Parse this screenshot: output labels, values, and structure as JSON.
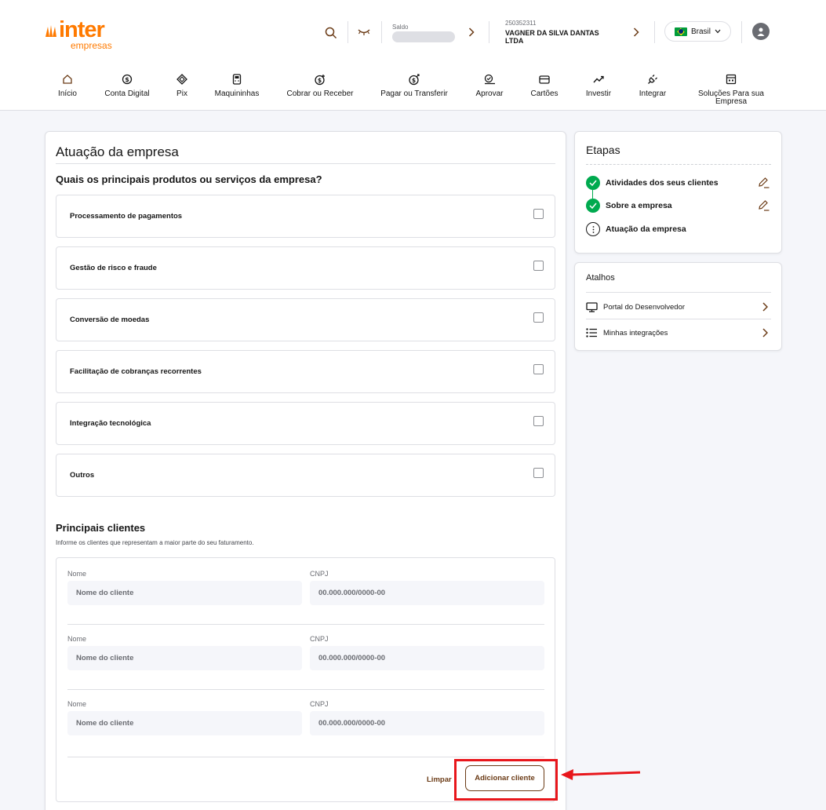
{
  "brand": {
    "name": "inter",
    "sub": "empresas",
    "color": "#ff7a00"
  },
  "header": {
    "saldo_label": "Saldo",
    "account_number": "250352311",
    "account_name": "VAGNER DA SILVA DANTAS LTDA",
    "country": "Brasil",
    "icons": [
      "search-icon",
      "hide-eye-icon",
      "chevron-right-icon",
      "user-icon"
    ]
  },
  "nav": [
    {
      "label": "Início",
      "icon": "home-icon"
    },
    {
      "label": "Conta Digital",
      "icon": "dollar-icon"
    },
    {
      "label": "Pix",
      "icon": "pix-icon"
    },
    {
      "label": "Maquininhas",
      "icon": "pos-icon"
    },
    {
      "label": "Cobrar ou Receber",
      "icon": "receive-icon"
    },
    {
      "label": "Pagar ou Transferir",
      "icon": "pay-icon"
    },
    {
      "label": "Aprovar",
      "icon": "approve-icon"
    },
    {
      "label": "Cartões",
      "icon": "card-icon"
    },
    {
      "label": "Investir",
      "icon": "invest-icon"
    },
    {
      "label": "Integrar",
      "icon": "plug-icon"
    },
    {
      "label": "Soluções Para sua Empresa",
      "icon": "store-icon"
    }
  ],
  "main": {
    "title": "Atuação da empresa",
    "question": "Quais os principais produtos ou serviços da empresa?",
    "options": [
      "Processamento de pagamentos",
      "Gestão de risco e fraude",
      "Conversão de moedas",
      "Facilitação de cobranças recorrentes",
      "Integração tecnológica",
      "Outros"
    ],
    "clients_title": "Principais clientes",
    "clients_hint": "Informe os clientes que representam a maior parte do seu faturamento.",
    "clients": [
      {
        "name_label": "Nome",
        "name_placeholder": "Nome do cliente",
        "cnpj_label": "CNPJ",
        "cnpj_placeholder": "00.000.000/0000-00"
      },
      {
        "name_label": "Nome",
        "name_placeholder": "Nome do cliente",
        "cnpj_label": "CNPJ",
        "cnpj_placeholder": "00.000.000/0000-00"
      },
      {
        "name_label": "Nome",
        "name_placeholder": "Nome do cliente",
        "cnpj_label": "CNPJ",
        "cnpj_placeholder": "00.000.000/0000-00"
      }
    ],
    "clear_label": "Limpar",
    "add_label": "Adicionar cliente"
  },
  "steps": {
    "title": "Etapas",
    "items": [
      {
        "label": "Atividades dos seus clientes",
        "status": "done"
      },
      {
        "label": "Sobre a empresa",
        "status": "done"
      },
      {
        "label": "Atuação da empresa",
        "status": "current"
      }
    ]
  },
  "shortcuts": {
    "title": "Atalhos",
    "items": [
      {
        "label": "Portal do Desenvolvedor",
        "icon": "monitor-icon"
      },
      {
        "label": "Minhas integrações",
        "icon": "list-icon"
      }
    ]
  },
  "colors": {
    "accent": "#ff7a00",
    "brown": "#6b3b16",
    "success": "#00aa4f",
    "highlight": "#e8161b"
  }
}
